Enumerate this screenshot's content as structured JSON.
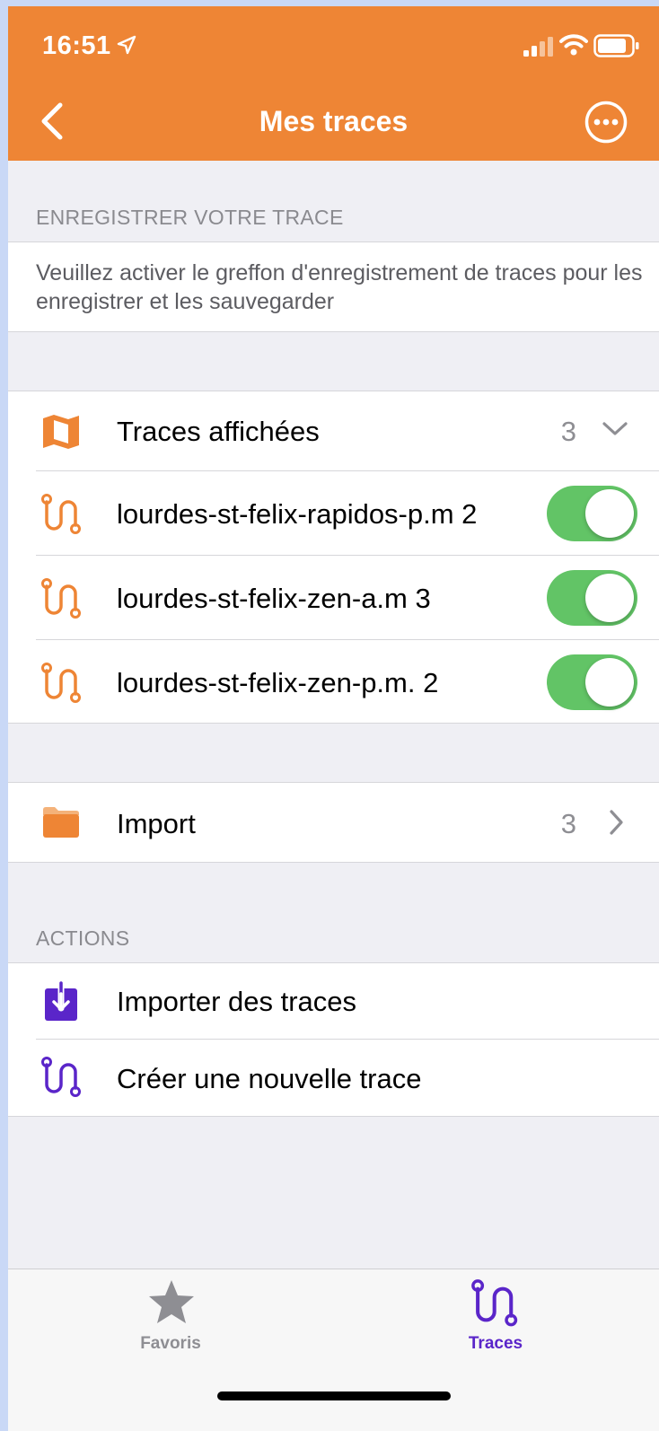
{
  "status_bar": {
    "time": "16:51"
  },
  "nav": {
    "title": "Mes traces"
  },
  "record_section": {
    "header": "ENREGISTRER VOTRE TRACE",
    "text": "Veuillez activer le greffon d'enregistrement de traces pour les enregistrer et les sauvegarder"
  },
  "displayed": {
    "label": "Traces affichées",
    "count": "3",
    "traces": [
      {
        "label": "lourdes-st-felix-rapidos-p.m 2",
        "enabled": true
      },
      {
        "label": "lourdes-st-felix-zen-a.m 3",
        "enabled": true
      },
      {
        "label": "lourdes-st-felix-zen-p.m. 2",
        "enabled": true
      }
    ]
  },
  "import_folder": {
    "label": "Import",
    "count": "3"
  },
  "actions": {
    "header": "ACTIONS",
    "items": [
      {
        "label": "Importer des traces",
        "icon": "import-icon"
      },
      {
        "label": "Créer une nouvelle trace",
        "icon": "route-icon"
      }
    ]
  },
  "tabbar": {
    "tabs": [
      {
        "label": "Favoris",
        "icon": "star-icon",
        "active": false
      },
      {
        "label": "Traces",
        "icon": "route-icon",
        "active": true
      }
    ]
  },
  "colors": {
    "accent": "#ee8535",
    "toggle_on": "#62c466",
    "action_purple": "#5a25c9",
    "tab_inactive": "#8e8e93"
  }
}
